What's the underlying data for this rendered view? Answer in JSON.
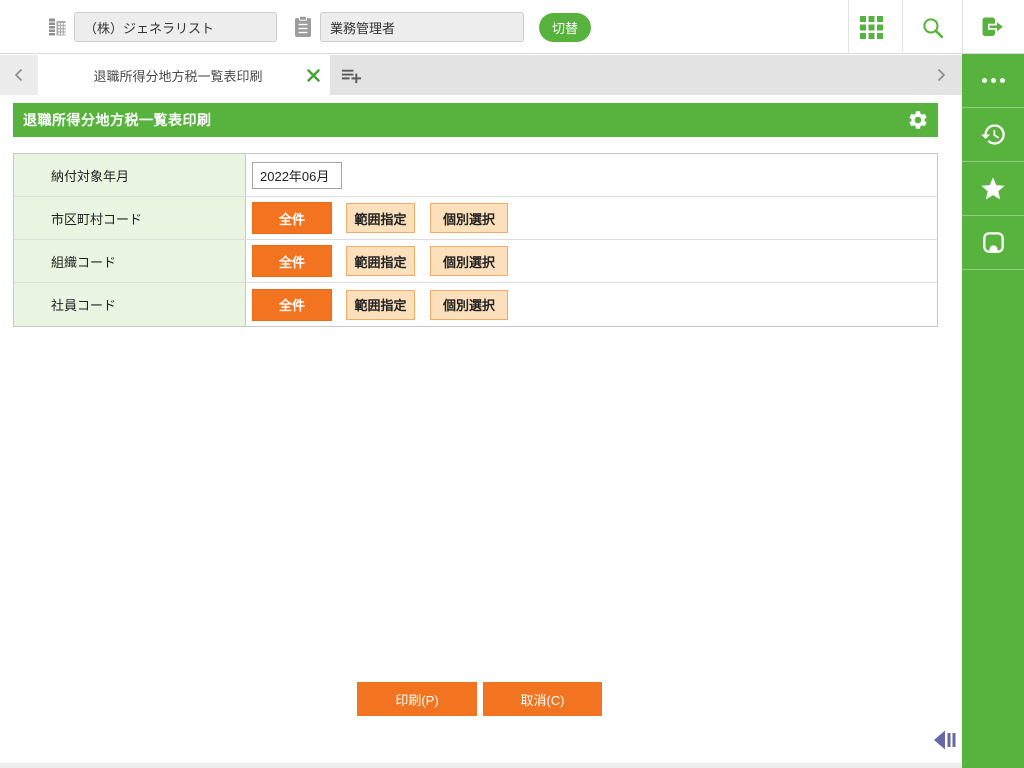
{
  "topbar": {
    "company_value": "（株）ジェネラリスト",
    "role_value": "業務管理者",
    "switch_label": "切替"
  },
  "tabbar": {
    "active_tab_label": "退職所得分地方税一覧表印刷"
  },
  "page": {
    "title": "退職所得分地方税一覧表印刷"
  },
  "form": {
    "rows": [
      {
        "label": "納付対象年月",
        "value": "2022年06月"
      },
      {
        "label": "市区町村コード"
      },
      {
        "label": "組織コード"
      },
      {
        "label": "社員コード"
      }
    ],
    "selection_buttons": {
      "all": "全件",
      "range": "範囲指定",
      "individual": "個別選択"
    },
    "selected_mode": "全件"
  },
  "actions": {
    "print_label": "印刷(P)",
    "cancel_label": "取消(C)"
  },
  "icons": {
    "topbar": [
      "company-building-icon",
      "clipboard-role-icon",
      "apps-grid-icon",
      "search-icon",
      "logout-icon"
    ],
    "tabbar": [
      "prev-tab-chevron-icon",
      "close-tab-icon",
      "add-tab-icon",
      "next-tab-chevron-icon"
    ],
    "sidebar": [
      "more-dots-icon",
      "history-icon",
      "favorite-star-icon",
      "bookmark-icon"
    ],
    "content": [
      "settings-gear-icon",
      "collapse-left-icon"
    ]
  },
  "colors": {
    "brand_green": "#57b33e",
    "accent_orange": "#f37420",
    "soft_orange": "#fce0bc",
    "label_row_green": "#e9f4e1"
  }
}
